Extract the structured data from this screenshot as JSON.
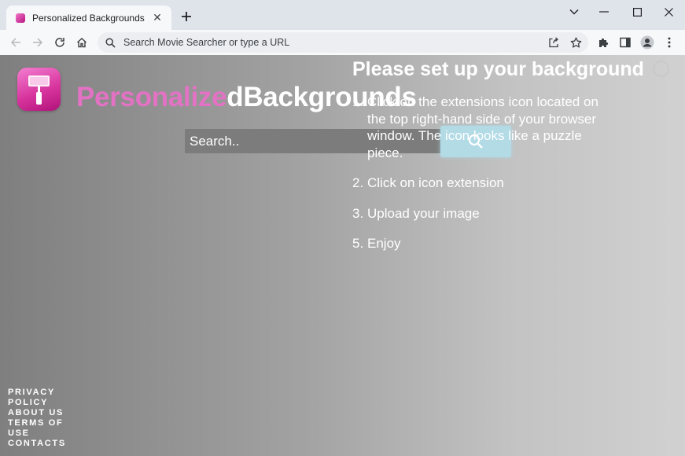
{
  "browser": {
    "tab_title": "Personalized Backgrounds",
    "omnibox_placeholder": "Search Movie Searcher or type a URL"
  },
  "icons": [
    "back-arrow-icon",
    "forward-arrow-icon",
    "reload-icon",
    "home-icon",
    "search-icon",
    "share-icon",
    "star-icon",
    "puzzle-icon",
    "side-panel-icon",
    "profile-icon",
    "more-vert-icon",
    "chevron-down-icon",
    "minimize-icon",
    "maximize-icon",
    "close-icon",
    "plus-icon",
    "spinner-icon"
  ],
  "brand": {
    "part1": "Personalize",
    "part2": "dBackgrounds"
  },
  "search": {
    "placeholder": "Search.."
  },
  "setup": {
    "title": "Please set up your background",
    "steps": [
      {
        "num": "1.",
        "text": "Click on the extensions icon located on the top right-hand side of your browser window. The icon looks like a puzzle piece."
      },
      {
        "num": "2.",
        "text": "Click on icon extension"
      },
      {
        "num": "3.",
        "text": "Upload your image"
      },
      {
        "num": "5.",
        "text": "Enjoy"
      }
    ]
  },
  "footer": {
    "privacy": "PRIVACY POLICY",
    "about": "ABOUT US",
    "terms": "TERMS OF USE",
    "contacts": "CONTACTS"
  },
  "colors": {
    "brand_pink": "#e472c4",
    "search_button": "#b2dbe6",
    "chrome_frame": "#dfe3ea"
  }
}
